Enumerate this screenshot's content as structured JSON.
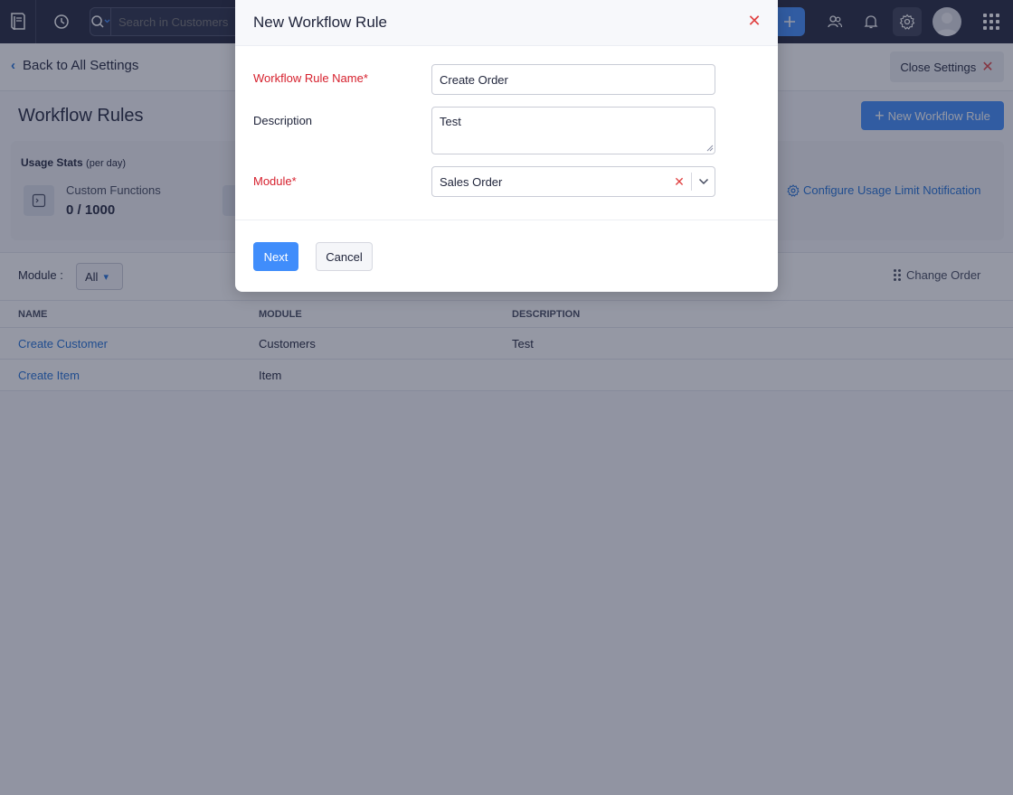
{
  "topbar": {
    "search_placeholder": "Search in Customers",
    "icons": [
      "logo-icon",
      "recent-history-icon",
      "search-icon",
      "chevron-down-icon",
      "plus-icon",
      "people-icon",
      "bell-icon",
      "gear-icon",
      "avatar",
      "app-grid-icon"
    ]
  },
  "settings": {
    "back_label": "Back to All Settings",
    "close_label": "Close Settings"
  },
  "page": {
    "title": "Workflow Rules",
    "new_button": "New Workflow Rule"
  },
  "usage": {
    "title": "Usage Stats",
    "per_day": "(per day)",
    "custom_functions_label": "Custom Functions",
    "custom_functions_value": "0 / 1000",
    "config_link": "Configure Usage Limit Notification"
  },
  "filter": {
    "module_label": "Module :",
    "module_value": "All",
    "change_order": "Change Order"
  },
  "table": {
    "headers": [
      "NAME",
      "MODULE",
      "DESCRIPTION"
    ],
    "rows": [
      {
        "name": "Create Customer",
        "module": "Customers",
        "description": "Test"
      },
      {
        "name": "Create Item",
        "module": "Item",
        "description": ""
      }
    ]
  },
  "modal": {
    "title": "New Workflow Rule",
    "name_label": "Workflow Rule Name*",
    "name_value": "Create Order",
    "description_label": "Description",
    "description_value": "Test",
    "module_label": "Module*",
    "module_value": "Sales Order",
    "next_label": "Next",
    "cancel_label": "Cancel"
  },
  "colors": {
    "topbar": "#21263c",
    "primary": "#408dfb",
    "link": "#1f6fd6",
    "required": "#d6202d",
    "close": "#e04141"
  }
}
